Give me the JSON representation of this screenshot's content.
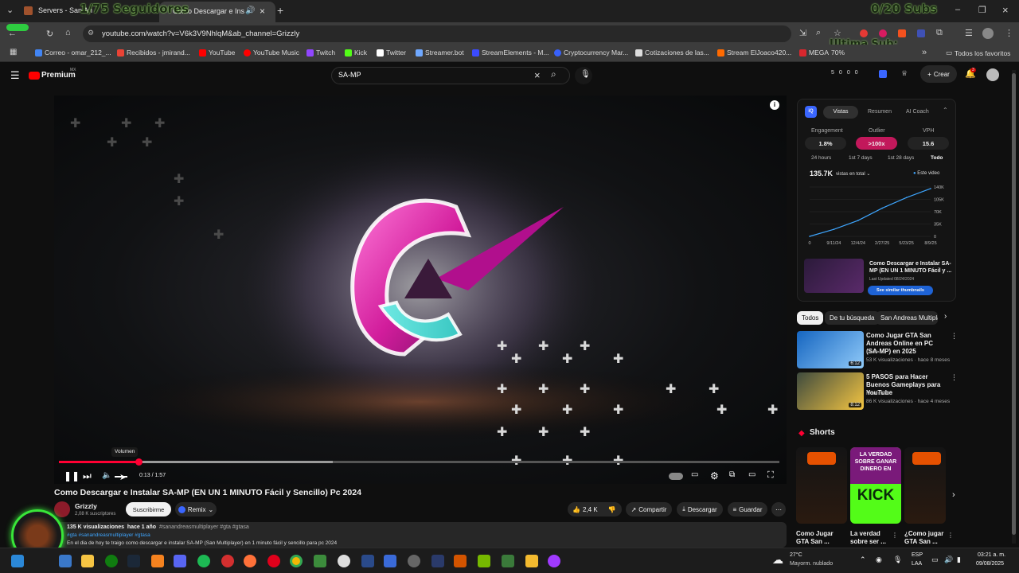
{
  "browser": {
    "tab_inactive_title": "Servers - San An",
    "tab_active_title": "Como Descargar e Insta",
    "url": "youtube.com/watch?v=V6k3V9NhlqM&ab_channel=Grizzly",
    "bookmarks": [
      {
        "label": "Correo - omar_212_...",
        "color": "#4285f4"
      },
      {
        "label": "Recibidos - jmirand...",
        "color": "#ea4335"
      },
      {
        "label": "YouTube",
        "color": "#ff0000"
      },
      {
        "label": "YouTube Music",
        "color": "#ff0000"
      },
      {
        "label": "Twitch",
        "color": "#9146ff"
      },
      {
        "label": "Kick",
        "color": "#53fc18"
      },
      {
        "label": "Twitter",
        "color": "#ffffff"
      },
      {
        "label": "Streamer.bot",
        "color": "#6fa8ff"
      },
      {
        "label": "StreamElements - M...",
        "color": "#3b4bff"
      },
      {
        "label": "Cryptocurrency Mar...",
        "color": "#3861fb"
      },
      {
        "label": "Cotizaciones de las...",
        "color": "#dddddd"
      },
      {
        "label": "Stream ElJoaco420...",
        "color": "#ff6a00"
      },
      {
        "label": "MEGA",
        "color": "#d9272e"
      }
    ],
    "all_favorites": "Todos los favoritos"
  },
  "overlays": {
    "counter_left": "1/75 Seguidores",
    "counter_right": "0/20 Subs",
    "mega_percent": "70%",
    "ultima_sub": "Ultima Sub:"
  },
  "youtube": {
    "logo": "Premium",
    "logo_region": "MX",
    "search_value": "SA-MP",
    "create_label": "Crear",
    "notif_count": "3",
    "header_stats": [
      "5",
      "0",
      "0",
      "0"
    ]
  },
  "video": {
    "current_time": "0:13",
    "duration": "1:57",
    "progress": 0.11,
    "buffered": 0.38,
    "tooltip": "Volumen",
    "title": "Como Descargar e Instalar SA-MP (EN UN 1 MINUTO Fácil y Sencillo) Pc 2024",
    "channel": "Grizzly",
    "subscribers": "2,08 K suscriptores",
    "subscribe_label": "Suscribirme",
    "remix_label": "Remix",
    "likes": "2,4 K",
    "share_label": "Compartir",
    "download_label": "Descargar",
    "save_label": "Guardar",
    "desc_views": "135 K visualizaciones",
    "desc_date": "hace 1 año",
    "desc_tags": "#sanandreasmultiplayer #gta #gtasa",
    "desc_line2_tags": "#gta #sanandreasmultiplayer #gtasa",
    "desc_line3": "En el dia de hoy te traigo como descargar e instalar SA-MP (San Multiplayer) en 1 minuto fácil y sencillo para pc 2024"
  },
  "ext_panel": {
    "tabs": [
      "Vistas",
      "Resumen",
      "AI Coach"
    ],
    "metrics": [
      {
        "label": "Engagement",
        "value": "1.8%"
      },
      {
        "label": "Outlier",
        "value": ">100x"
      },
      {
        "label": "VPH",
        "value": "15.6"
      }
    ],
    "ranges": [
      "24 hours",
      "1st 7 days",
      "1st 28 days",
      "Todo"
    ],
    "total_views": "135.7K",
    "total_views_label": "vistas en total",
    "legend": "Este video",
    "y_ticks": [
      "140K",
      "105K",
      "70K",
      "35K",
      "0"
    ],
    "x_ticks": [
      "0",
      "9/11/24",
      "12/4/24",
      "2/27/25",
      "5/23/25",
      "8/9/25"
    ],
    "thumb_title": "Como Descargar e Instalar SA-MP (EN UN 1 MINUTO Fácil y ...",
    "last_updated": "Last Updated 08/24/2024",
    "similar_btn": "See similar thumbnails"
  },
  "chart_data": {
    "type": "line",
    "x": [
      "0",
      "9/11/24",
      "12/4/24",
      "2/27/25",
      "5/23/25",
      "8/9/25"
    ],
    "series": [
      {
        "name": "Este video",
        "values": [
          0,
          20000,
          45000,
          80000,
          110000,
          135700
        ]
      }
    ],
    "ylim": [
      0,
      140000
    ]
  },
  "filters": [
    "Todos",
    "De tu búsqueda",
    "San Andreas Multipla"
  ],
  "recommendations": [
    {
      "title": "Como Jugar GTA San Andreas Online en PC (SA-MP) en 2025",
      "channel": "Dixel",
      "meta": "53 K visualizaciones · hace 8 meses",
      "duration": "6:12"
    },
    {
      "title": "5 PASOS para Hacer Buenos Gameplays para YouTube",
      "channel": "Mitormento",
      "meta": "86 K visualizaciones · hace 4 meses",
      "duration": "8:12"
    }
  ],
  "shorts": {
    "heading": "Shorts",
    "items": [
      {
        "title": "Como Jugar GTA San ..."
      },
      {
        "title": "La verdad sobre ser ..."
      },
      {
        "title": "¿Como jugar GTA San ..."
      }
    ],
    "kick_text_1": "LA VERDAD SOBRE GANAR DINERO EN",
    "kick_text_2": "KICK"
  },
  "taskbar": {
    "temp": "27°C",
    "weather": "Mayorm. nublado",
    "lang": "ESP",
    "lang2": "LAA",
    "time": "03:21 a. m.",
    "date": "09/08/2025"
  }
}
